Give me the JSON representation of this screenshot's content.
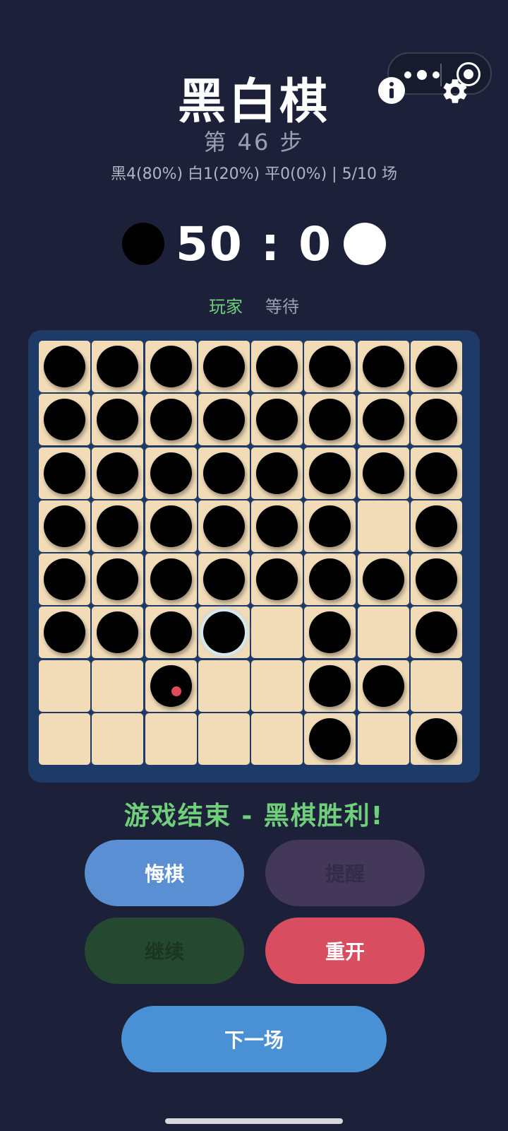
{
  "header": {
    "title": "黑白棋",
    "step": "第 46 步",
    "stats": "黑4(80%) 白1(20%) 平0(0%) | 5/10 场"
  },
  "score": {
    "text": "50 : 0",
    "black": 50,
    "white": 0
  },
  "turn": {
    "player": "玩家",
    "waiting": "等待"
  },
  "board": {
    "size": 8,
    "rows": [
      "BBBBBBBB",
      "BBBBBBBB",
      "BBBBBBBB",
      "BBBBBB.B",
      "BBBBBBBB",
      "BBBB.B.B",
      "..B..BB.",
      ".....B.B"
    ],
    "last_move": [
      5,
      3
    ],
    "marker": [
      6,
      2
    ]
  },
  "result": "游戏结束 - 黑棋胜利!",
  "buttons": {
    "undo": "悔棋",
    "hint": "提醒",
    "continue": "继续",
    "restart": "重开",
    "next": "下一场"
  },
  "colors": {
    "background": "#1c2139",
    "board_frame": "#1e3a66",
    "cell": "#f2dcb8",
    "accent_green": "#6fcf7a",
    "marker_red": "#e04a5a"
  },
  "icons": {
    "capsule_menu": "more-dots-icon",
    "capsule_close": "target-icon",
    "info": "info-icon",
    "settings": "gear-icon"
  }
}
